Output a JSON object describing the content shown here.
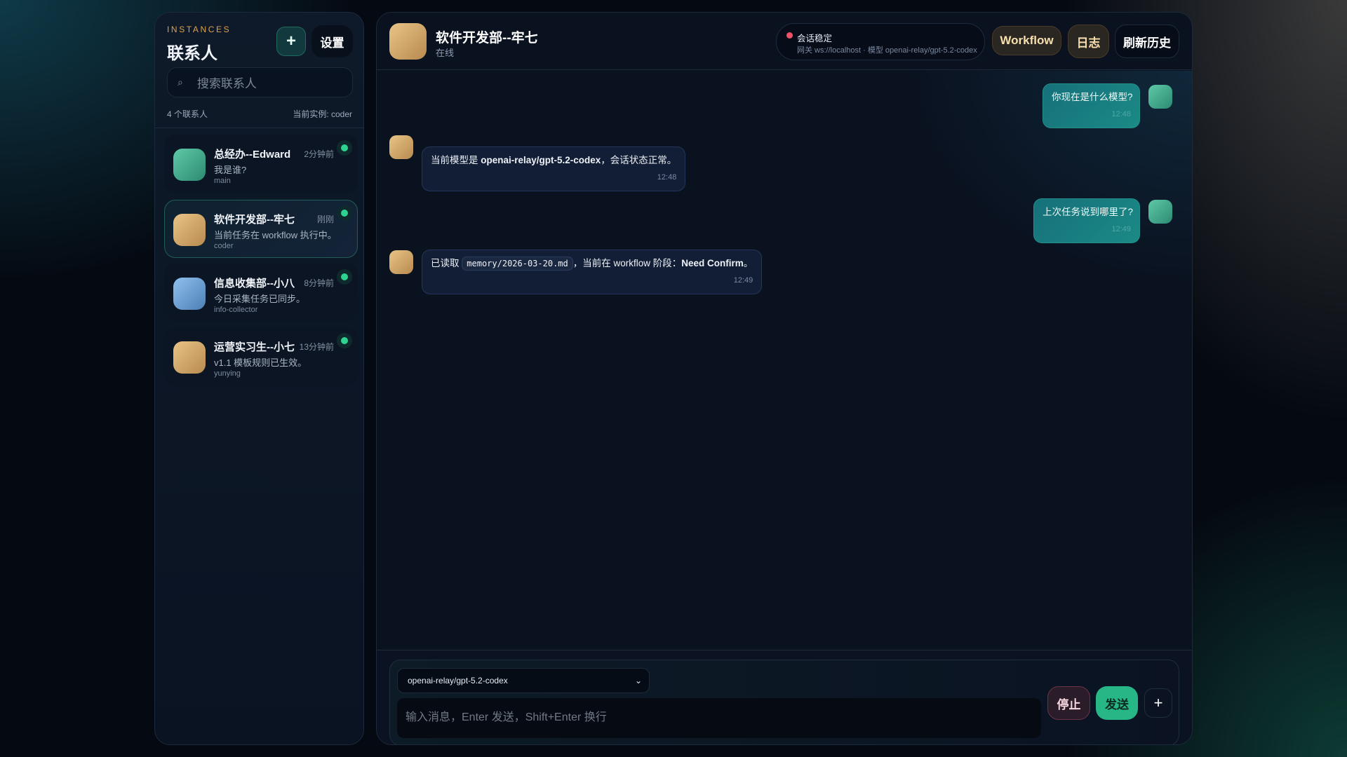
{
  "sidebar": {
    "eyebrow": "INSTANCES",
    "title": "联系人",
    "add_label": "+",
    "settings_label": "设置",
    "search_placeholder": "搜索联系人",
    "search_icon": "⌕",
    "count": "4 个联系人",
    "current_instance": "当前实例: coder",
    "contacts": [
      {
        "name": "总经办--Edward",
        "time": "2分钟前",
        "preview": "我是谁?",
        "instance": "main"
      },
      {
        "name": "软件开发部--牢七",
        "time": "刚刚",
        "preview": "当前任务在 workflow 执行中。",
        "instance": "coder"
      },
      {
        "name": "信息收集部--小八",
        "time": "8分钟前",
        "preview": "今日采集任务已同步。",
        "instance": "info-collector"
      },
      {
        "name": "运营实习生--小七",
        "time": "13分钟前",
        "preview": "v1.1 模板规则已生效。",
        "instance": "yunying"
      }
    ]
  },
  "header": {
    "title": "软件开发部--牢七",
    "status": "在线",
    "session_status": "会话稳定",
    "gateway": "网关 ws://localhost · 模型 openai-relay/gpt-5.2-codex",
    "workflow_label": "Workflow",
    "log_label": "日志",
    "refresh_label": "刷新历史"
  },
  "messages": [
    {
      "role": "user",
      "text": "你现在是什么模型?",
      "time": "12:48"
    },
    {
      "role": "assistant",
      "pre": "当前模型是 ",
      "bold": "openai-relay/gpt-5.2-codex",
      "post": "，会话状态正常。",
      "time": "12:48"
    },
    {
      "role": "user",
      "text": "上次任务说到哪里了?",
      "time": "12:49"
    },
    {
      "role": "assistant",
      "pre": "已读取 ",
      "code": "memory/2026-03-20.md",
      "mid": "，当前在 workflow 阶段：",
      "bold": "Need Confirm",
      "post": "。",
      "time": "12:49"
    }
  ],
  "composer": {
    "model": "openai-relay/gpt-5.2-codex",
    "placeholder": "输入消息，Enter 发送，Shift+Enter 换行",
    "stop_label": "停止",
    "send_label": "发送",
    "attach_label": "+"
  }
}
